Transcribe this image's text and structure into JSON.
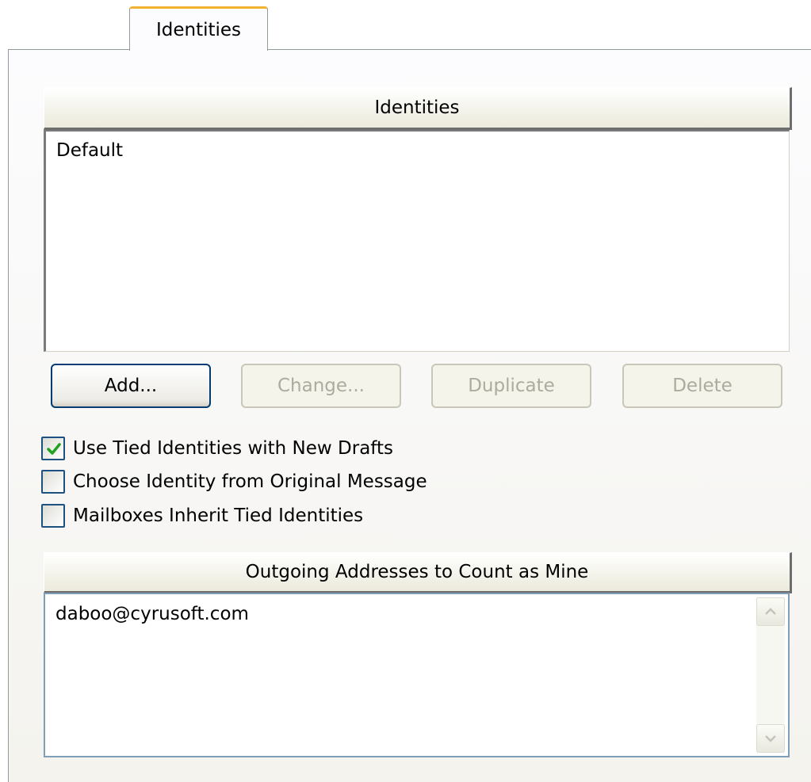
{
  "tab": {
    "label": "Identities"
  },
  "identities": {
    "header": "Identities",
    "items": [
      "Default"
    ]
  },
  "buttons": {
    "add": "Add...",
    "change": "Change...",
    "duplicate": "Duplicate",
    "delete": "Delete"
  },
  "options": [
    {
      "label": "Use Tied Identities with New Drafts",
      "checked": true
    },
    {
      "label": "Choose Identity from Original Message",
      "checked": false
    },
    {
      "label": "Mailboxes Inherit Tied Identities",
      "checked": false
    }
  ],
  "addresses": {
    "header": "Outgoing Addresses to Count as Mine",
    "items": [
      "daboo@cyrusoft.com"
    ]
  },
  "colors": {
    "tab_accent": "#f2b332",
    "check": "#21a121",
    "focus_border": "#003c74"
  }
}
